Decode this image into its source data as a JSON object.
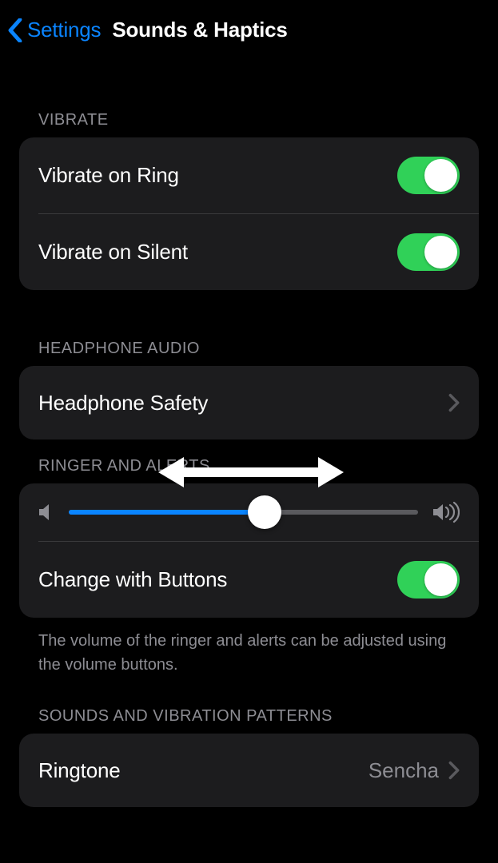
{
  "nav": {
    "back_label": "Settings",
    "title": "Sounds & Haptics"
  },
  "sections": {
    "vibrate": {
      "header": "VIBRATE",
      "rows": {
        "ring": {
          "label": "Vibrate on Ring",
          "on": true
        },
        "silent": {
          "label": "Vibrate on Silent",
          "on": true
        }
      }
    },
    "headphone": {
      "header": "HEADPHONE AUDIO",
      "rows": {
        "safety": {
          "label": "Headphone Safety"
        }
      }
    },
    "ringer": {
      "header": "RINGER AND ALERTS",
      "slider": {
        "value": 0.56
      },
      "change_buttons": {
        "label": "Change with Buttons",
        "on": true
      },
      "footer": "The volume of the ringer and alerts can be adjusted using the volume buttons."
    },
    "sounds": {
      "header": "SOUNDS AND VIBRATION PATTERNS",
      "rows": {
        "ringtone": {
          "label": "Ringtone",
          "value": "Sencha"
        }
      }
    }
  }
}
